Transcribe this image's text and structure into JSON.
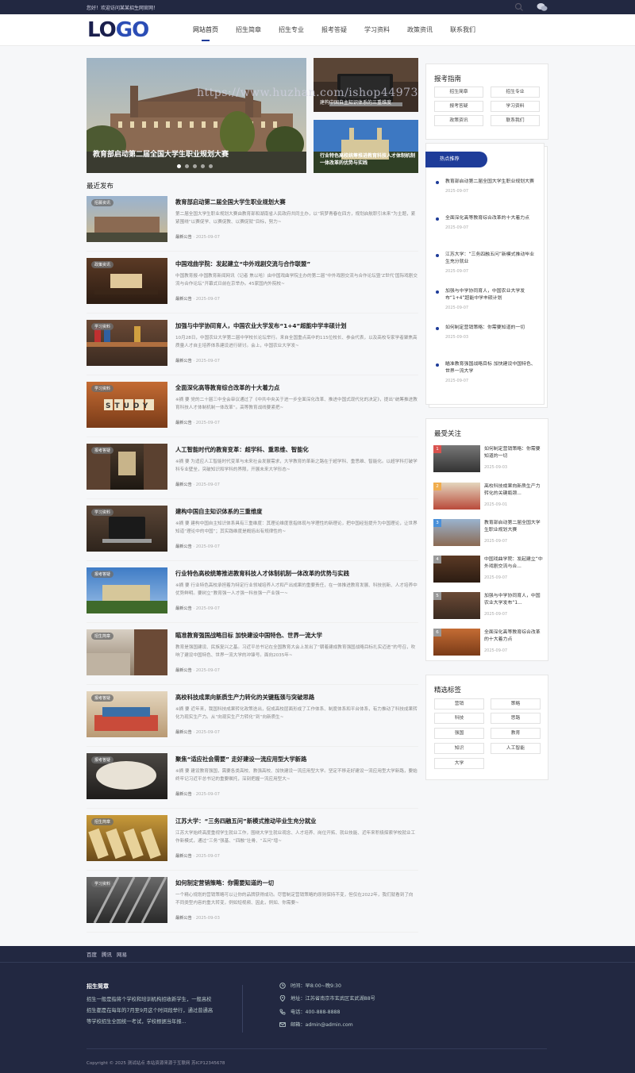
{
  "topbar": {
    "welcome": "您好！欢迎访问某某招生网官网！"
  },
  "logo": {
    "part1": "LO",
    "part2": "GO"
  },
  "nav": [
    "网站首页",
    "招生简章",
    "招生专业",
    "报考答疑",
    "学习资料",
    "政策资讯",
    "联系我们"
  ],
  "slider": {
    "main_caption": "教育部启动第二届全国大学生职业规划大赛",
    "thumb1_caption": "建构中国自主知识体系的三重维度",
    "thumb2_caption": "行业特色高校统筹推进教育科技人才体制机制一体改革的优势与实践"
  },
  "watermark": "https://www.huzhan.com/ishop44973",
  "section_title": "最近发布",
  "articles": [
    {
      "tag": "招募资讯",
      "title": "教育部启动第二届全国大学生职业规划大赛",
      "desc": "第二届全国大学生职业规划大赛由教育部和湖南省人民政府共同主办，以“筑梦青春在四方，规划启航职引未来”为主题，紧紧围绕“以赛促学、以赛促教、以赛促就”目标，努力~",
      "cat": "最新公告",
      "date": "2025-09-07"
    },
    {
      "tag": "政策资讯",
      "title": "中国戏曲学院：发起建立“中外戏剧交流与合作联盟”",
      "desc": "中国教育报-中国教育新闻网讯（记者 焦以哈）由中国戏曲学院主办的第二届“中外戏剧交流与合作论坛暨‘Z世代’国际戏剧交流与合作论坛”开幕式日前在京举办。45家国内外院校~",
      "cat": "最新公告",
      "date": "2025-09-07"
    },
    {
      "tag": "学习资料",
      "title": "加强与中学协同育人，中国农业大学发布“1+4”超能中学丰硕计划",
      "desc": "10月28日，中国农业大学第二届中学校长论坛举行。来自全国重点高中的115位校长、参会代表，以及高校专家学者聚焦高质量人才自主培养体系建设进行研讨。会上，中国农业大学发~",
      "cat": "最新公告",
      "date": "2025-09-07"
    },
    {
      "tag": "学习资料",
      "title": "全面深化高等教育综合改革的十大着力点",
      "desc": "※摘 要 党的二十届三中全会审议通过了《中共中央关于进一步全面深化改革、推进中国式现代化的决定》，提出“统筹推进教育科技人才体制机制一体改革”。高等教育战线要紧把~",
      "cat": "最新公告",
      "date": "2025-09-07"
    },
    {
      "tag": "报考答疑",
      "title": "人工智能时代的教育变革：超学科、重思维、智能化",
      "desc": "※摘 要 为适应人工智能时代变革与未来社会发展需求，大学教育的革新之路在于超学科、重思维、智能化。以超学科打破学科专业壁垒，突破知识和学科的界限，开展未来大学形态~",
      "cat": "最新公告",
      "date": "2025-09-07"
    },
    {
      "tag": "学习资料",
      "title": "建构中国自主知识体系的三重维度",
      "desc": "※摘 要 建构中国自主知识体系具有三重维度：其理论维度意指体现与学理性的新理论，把中国经验提升为中国理论，让世界知道“理论中的中国”；其实践维度是概括出有规律性的~",
      "cat": "最新公告",
      "date": "2025-09-07"
    },
    {
      "tag": "报考答疑",
      "title": "行业特色高校统筹推进教育科技人才体制机制一体改革的优势与实践",
      "desc": "※摘 要 行业特色高校承担着为特定行业领域培养人才和产出成果的重要责任，在一体推进教育发展、科技创新、人才培养中优势鲜明。要树立“教育强一人才强一科技强一产业强一~",
      "cat": "最新公告",
      "date": "2025-09-07"
    },
    {
      "tag": "招生简章",
      "title": "瞄准教育强国战略目标 加快建设中国特色、世界一流大学",
      "desc": "教育是强国建设、民族复兴之基。习近平总书记在全国教育大会上发出了“朝着建成教育强国战略目标扎实迈进”的号召，吹响了建设中国特色、世界一流大学的冲锋号。面向2035年~",
      "cat": "最新公告",
      "date": "2025-09-07"
    },
    {
      "tag": "报考答疑",
      "title": "高校科技成果向新质生产力转化的关键瓶颈与突破思路",
      "desc": "※摘 要 近年来，我国科技成果转化政策迭出，促成高校层面形成了工作体系、制度体系和平台体系，有力推动了科技成果转化为现实生产力。从“向现实生产力转化”到“向新质生~",
      "cat": "最新公告",
      "date": "2025-09-07"
    },
    {
      "tag": "报考答疑",
      "title": "聚焦“适应社会需要” 走好建设一流应用型大学新路",
      "desc": "※摘 要 建设教育强国，需要各类高校、教强高校、加快建设一流应用型大学。坚定不移走好建设一流应用型大学新路，要始终牢记习近平总书记的重要嘱托，深刻把握一流应用型大~",
      "cat": "最新公告",
      "date": "2025-09-07"
    },
    {
      "tag": "招生简章",
      "title": "江苏大学：“三务四融五问”新模式推动毕业生充分就业",
      "desc": "江苏大学始终高度重视学生就业工作，围绕大学生就业观念、人才培养、岗位开拓、就业技能、近年来积极探索学校就业工作新模式，通过“三务”强基、“四融”壮骨、“五问”增~",
      "cat": "最新公告",
      "date": "2025-09-07"
    },
    {
      "tag": "学习资料",
      "title": "如何制定营销策略：你需要知道的一切",
      "desc": "一个精心规划的营销策略可以让你的品牌获得成功。尽管制定营销策略的原则保持不变，但仅在2022年，我们就看到了向不同类型内容的重大转变，例如短视频、因此，例如、你需要~",
      "cat": "最新公告",
      "date": "2025-09-03"
    }
  ],
  "sidebar": {
    "guide": {
      "title": "报考指南",
      "buttons": [
        "招生简章",
        "招生专业",
        "报考答疑",
        "学习资料",
        "政策资讯",
        "联系我们"
      ]
    },
    "hot": {
      "title": "热点推荐",
      "items": [
        {
          "t": "教育部启动第二届全国大学生职业规划大赛",
          "d": "2025-09-07"
        },
        {
          "t": "全面深化高等教育综合改革的十大着力点",
          "d": "2025-09-07"
        },
        {
          "t": "江苏大学：“三务四融五问”新模式推动毕业生充分就业",
          "d": "2025-09-07"
        },
        {
          "t": "加强与中学协同育人，中国农业大学发布“1+4”超能中学丰硕计划",
          "d": "2025-09-07"
        },
        {
          "t": "如何制定营销策略：你需要知道的一切",
          "d": "2025-09-03"
        },
        {
          "t": "瞄准教育强国战略目标 加快建设中国特色、世界一流大学",
          "d": "2025-09-07"
        }
      ]
    },
    "focus": {
      "title": "最受关注",
      "items": [
        {
          "n": "1",
          "t": "如何制定营销策略：你需要知道的一切",
          "d": "2025-09-03"
        },
        {
          "n": "2",
          "t": "高校科技成果向新质生产力转化的关键瓶颈...",
          "d": "2025-09-01"
        },
        {
          "n": "3",
          "t": "教育部启动第二届全国大学生职业规划大赛",
          "d": "2025-09-07"
        },
        {
          "n": "4",
          "t": "中国戏曲学院：发起建立“中外戏剧交流与合...",
          "d": "2025-09-07"
        },
        {
          "n": "5",
          "t": "加强与中学协同育人，中国农业大学发布“1...",
          "d": "2025-09-07"
        },
        {
          "n": "6",
          "t": "全面深化高等教育综合改革的十大着力点",
          "d": "2025-09-07"
        }
      ]
    },
    "tags": {
      "title": "精选标签",
      "items": [
        "营销",
        "策略",
        "科技",
        "思路",
        "强国",
        "教育",
        "知识",
        "人工智能",
        "大学"
      ]
    }
  },
  "footer": {
    "links": [
      "百度",
      "腾讯",
      "网易"
    ],
    "about_title": "招生简章",
    "about_text": "招生一般是指将个学校和培训机构招收新学生，一般高校招生都是在每年的7月至9月这个时间段举行，通过普通高等学校招生全国统一考试，学校根据当年报...",
    "time": "时间：早8:00~晚9:30",
    "addr": "地址：江苏省南京市玄武区玄武湖88号",
    "tel": "电话：400-888-8888",
    "email": "邮箱：admin@admin.com",
    "copyright": "Copyright © 2025 测试站点 本站资源来源于互联网 苏ICP12345678"
  }
}
